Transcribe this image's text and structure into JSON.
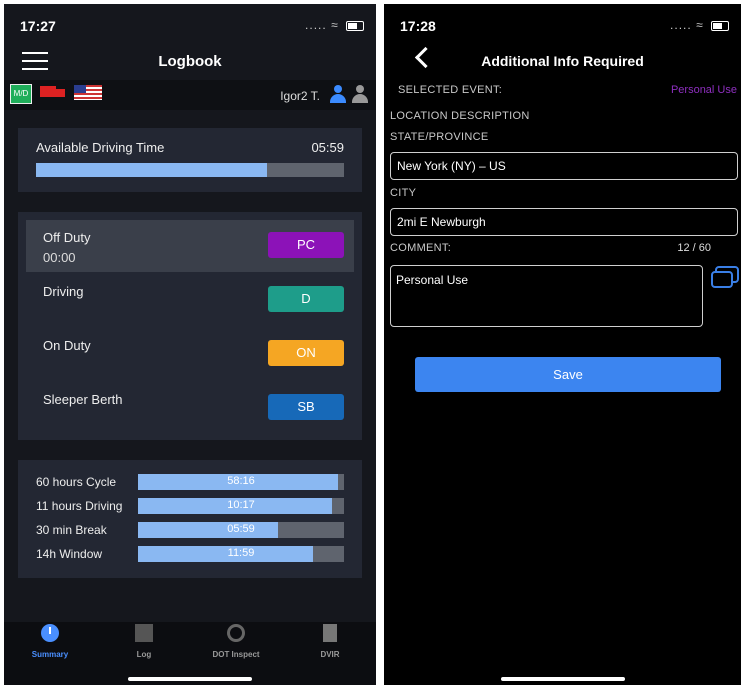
{
  "left": {
    "status_bar": {
      "time": "17:27",
      "signal": "....."
    },
    "header": {
      "title": "Logbook"
    },
    "subbar": {
      "md_label": "M/D",
      "driver_name": "Igor2 T."
    },
    "available": {
      "label": "Available Driving Time",
      "value": "05:59",
      "fill": 0.75
    },
    "statuses": [
      {
        "name": "Off Duty",
        "time": "00:00",
        "button": "PC",
        "color": "#8c12b8",
        "active": true
      },
      {
        "name": "Driving",
        "button": "D",
        "color": "#1e9d8a"
      },
      {
        "name": "On Duty",
        "button": "ON",
        "color": "#f5a623"
      },
      {
        "name": "Sleeper Berth",
        "button": "SB",
        "color": "#1769b8"
      }
    ],
    "cycles": [
      {
        "label": "60 hours Cycle",
        "value": "58:16",
        "fill": 0.97
      },
      {
        "label": "11 hours Driving",
        "value": "10:17",
        "fill": 0.94
      },
      {
        "label": "30 min Break",
        "value": "05:59",
        "fill": 0.68
      },
      {
        "label": "14h Window",
        "value": "11:59",
        "fill": 0.85
      }
    ],
    "tabs": [
      {
        "label": "Summary",
        "icon": "clock-icon",
        "active": true
      },
      {
        "label": "Log",
        "icon": "graph-icon"
      },
      {
        "label": "DOT Inspect",
        "icon": "inspect-icon"
      },
      {
        "label": "DVIR",
        "icon": "document-icon"
      }
    ]
  },
  "right": {
    "status_bar": {
      "time": "17:28",
      "signal": "....."
    },
    "header": {
      "title": "Additional Info Required"
    },
    "selected_event": {
      "label": "SELECTED EVENT:",
      "value": "Personal Use"
    },
    "location_label": "LOCATION DESCRIPTION",
    "state": {
      "label": "STATE/PROVINCE",
      "value": "New York (NY) – US"
    },
    "city": {
      "label": "CITY",
      "value": "2mi E Newburgh"
    },
    "comment": {
      "label": "COMMENT:",
      "counter": "12 / 60",
      "value": "Personal Use"
    },
    "save_label": "Save",
    "accent": "#3c85f0"
  }
}
